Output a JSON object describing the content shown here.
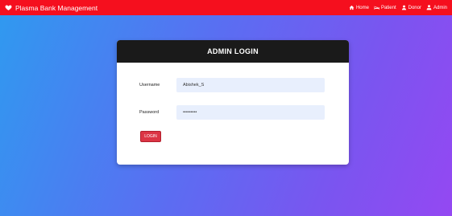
{
  "navbar": {
    "brand": "Plasma Bank Management",
    "links": [
      {
        "label": "Home",
        "icon": "home-icon"
      },
      {
        "label": "Patient",
        "icon": "bed-icon"
      },
      {
        "label": "Donor",
        "icon": "user-icon"
      },
      {
        "label": "Admin",
        "icon": "user-tie-icon"
      }
    ],
    "color": "#f50f1e"
  },
  "login": {
    "title": "ADMIN LOGIN",
    "username_label": "Username",
    "username_value": "Abishek_S",
    "password_label": "Password",
    "password_value": "abishek12",
    "button_label": "LOGIN"
  },
  "colors": {
    "header": "#1a1a1a",
    "input_bg": "#e8effd",
    "button": "#dc3545"
  }
}
